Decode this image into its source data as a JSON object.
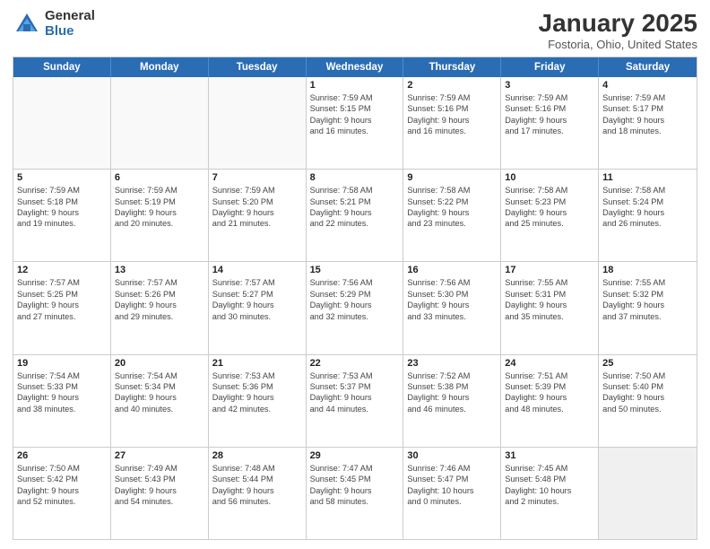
{
  "logo": {
    "general": "General",
    "blue": "Blue"
  },
  "header": {
    "month": "January 2025",
    "location": "Fostoria, Ohio, United States"
  },
  "weekdays": [
    "Sunday",
    "Monday",
    "Tuesday",
    "Wednesday",
    "Thursday",
    "Friday",
    "Saturday"
  ],
  "rows": [
    [
      {
        "day": "",
        "info": [],
        "empty": true
      },
      {
        "day": "",
        "info": [],
        "empty": true
      },
      {
        "day": "",
        "info": [],
        "empty": true
      },
      {
        "day": "1",
        "info": [
          "Sunrise: 7:59 AM",
          "Sunset: 5:15 PM",
          "Daylight: 9 hours",
          "and 16 minutes."
        ]
      },
      {
        "day": "2",
        "info": [
          "Sunrise: 7:59 AM",
          "Sunset: 5:16 PM",
          "Daylight: 9 hours",
          "and 16 minutes."
        ]
      },
      {
        "day": "3",
        "info": [
          "Sunrise: 7:59 AM",
          "Sunset: 5:16 PM",
          "Daylight: 9 hours",
          "and 17 minutes."
        ]
      },
      {
        "day": "4",
        "info": [
          "Sunrise: 7:59 AM",
          "Sunset: 5:17 PM",
          "Daylight: 9 hours",
          "and 18 minutes."
        ]
      }
    ],
    [
      {
        "day": "5",
        "info": [
          "Sunrise: 7:59 AM",
          "Sunset: 5:18 PM",
          "Daylight: 9 hours",
          "and 19 minutes."
        ]
      },
      {
        "day": "6",
        "info": [
          "Sunrise: 7:59 AM",
          "Sunset: 5:19 PM",
          "Daylight: 9 hours",
          "and 20 minutes."
        ]
      },
      {
        "day": "7",
        "info": [
          "Sunrise: 7:59 AM",
          "Sunset: 5:20 PM",
          "Daylight: 9 hours",
          "and 21 minutes."
        ]
      },
      {
        "day": "8",
        "info": [
          "Sunrise: 7:58 AM",
          "Sunset: 5:21 PM",
          "Daylight: 9 hours",
          "and 22 minutes."
        ]
      },
      {
        "day": "9",
        "info": [
          "Sunrise: 7:58 AM",
          "Sunset: 5:22 PM",
          "Daylight: 9 hours",
          "and 23 minutes."
        ]
      },
      {
        "day": "10",
        "info": [
          "Sunrise: 7:58 AM",
          "Sunset: 5:23 PM",
          "Daylight: 9 hours",
          "and 25 minutes."
        ]
      },
      {
        "day": "11",
        "info": [
          "Sunrise: 7:58 AM",
          "Sunset: 5:24 PM",
          "Daylight: 9 hours",
          "and 26 minutes."
        ]
      }
    ],
    [
      {
        "day": "12",
        "info": [
          "Sunrise: 7:57 AM",
          "Sunset: 5:25 PM",
          "Daylight: 9 hours",
          "and 27 minutes."
        ]
      },
      {
        "day": "13",
        "info": [
          "Sunrise: 7:57 AM",
          "Sunset: 5:26 PM",
          "Daylight: 9 hours",
          "and 29 minutes."
        ]
      },
      {
        "day": "14",
        "info": [
          "Sunrise: 7:57 AM",
          "Sunset: 5:27 PM",
          "Daylight: 9 hours",
          "and 30 minutes."
        ]
      },
      {
        "day": "15",
        "info": [
          "Sunrise: 7:56 AM",
          "Sunset: 5:29 PM",
          "Daylight: 9 hours",
          "and 32 minutes."
        ]
      },
      {
        "day": "16",
        "info": [
          "Sunrise: 7:56 AM",
          "Sunset: 5:30 PM",
          "Daylight: 9 hours",
          "and 33 minutes."
        ]
      },
      {
        "day": "17",
        "info": [
          "Sunrise: 7:55 AM",
          "Sunset: 5:31 PM",
          "Daylight: 9 hours",
          "and 35 minutes."
        ]
      },
      {
        "day": "18",
        "info": [
          "Sunrise: 7:55 AM",
          "Sunset: 5:32 PM",
          "Daylight: 9 hours",
          "and 37 minutes."
        ]
      }
    ],
    [
      {
        "day": "19",
        "info": [
          "Sunrise: 7:54 AM",
          "Sunset: 5:33 PM",
          "Daylight: 9 hours",
          "and 38 minutes."
        ]
      },
      {
        "day": "20",
        "info": [
          "Sunrise: 7:54 AM",
          "Sunset: 5:34 PM",
          "Daylight: 9 hours",
          "and 40 minutes."
        ]
      },
      {
        "day": "21",
        "info": [
          "Sunrise: 7:53 AM",
          "Sunset: 5:36 PM",
          "Daylight: 9 hours",
          "and 42 minutes."
        ]
      },
      {
        "day": "22",
        "info": [
          "Sunrise: 7:53 AM",
          "Sunset: 5:37 PM",
          "Daylight: 9 hours",
          "and 44 minutes."
        ]
      },
      {
        "day": "23",
        "info": [
          "Sunrise: 7:52 AM",
          "Sunset: 5:38 PM",
          "Daylight: 9 hours",
          "and 46 minutes."
        ]
      },
      {
        "day": "24",
        "info": [
          "Sunrise: 7:51 AM",
          "Sunset: 5:39 PM",
          "Daylight: 9 hours",
          "and 48 minutes."
        ]
      },
      {
        "day": "25",
        "info": [
          "Sunrise: 7:50 AM",
          "Sunset: 5:40 PM",
          "Daylight: 9 hours",
          "and 50 minutes."
        ]
      }
    ],
    [
      {
        "day": "26",
        "info": [
          "Sunrise: 7:50 AM",
          "Sunset: 5:42 PM",
          "Daylight: 9 hours",
          "and 52 minutes."
        ]
      },
      {
        "day": "27",
        "info": [
          "Sunrise: 7:49 AM",
          "Sunset: 5:43 PM",
          "Daylight: 9 hours",
          "and 54 minutes."
        ]
      },
      {
        "day": "28",
        "info": [
          "Sunrise: 7:48 AM",
          "Sunset: 5:44 PM",
          "Daylight: 9 hours",
          "and 56 minutes."
        ]
      },
      {
        "day": "29",
        "info": [
          "Sunrise: 7:47 AM",
          "Sunset: 5:45 PM",
          "Daylight: 9 hours",
          "and 58 minutes."
        ]
      },
      {
        "day": "30",
        "info": [
          "Sunrise: 7:46 AM",
          "Sunset: 5:47 PM",
          "Daylight: 10 hours",
          "and 0 minutes."
        ]
      },
      {
        "day": "31",
        "info": [
          "Sunrise: 7:45 AM",
          "Sunset: 5:48 PM",
          "Daylight: 10 hours",
          "and 2 minutes."
        ]
      },
      {
        "day": "",
        "info": [],
        "empty": true,
        "shaded": true
      }
    ]
  ]
}
